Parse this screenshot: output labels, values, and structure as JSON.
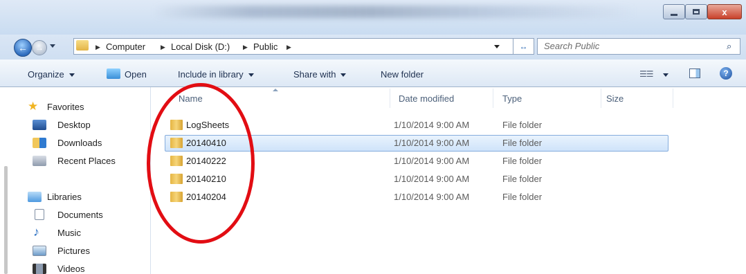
{
  "window": {
    "close_glyph": "x"
  },
  "address": {
    "crumbs": [
      "Computer",
      "Local Disk (D:)",
      "Public"
    ],
    "search_placeholder": "Search Public"
  },
  "toolbar": {
    "organize": "Organize",
    "open": "Open",
    "include_in_library": "Include in library",
    "share_with": "Share with",
    "new_folder": "New folder"
  },
  "nav": {
    "favorites_header": "Favorites",
    "favorites": [
      "Desktop",
      "Downloads",
      "Recent Places"
    ],
    "libraries_header": "Libraries",
    "libraries": [
      "Documents",
      "Music",
      "Pictures",
      "Videos"
    ]
  },
  "columns": {
    "name": "Name",
    "date_modified": "Date modified",
    "type": "Type",
    "size": "Size"
  },
  "files": [
    {
      "name": "LogSheets",
      "date": "1/10/2014 9:00 AM",
      "type": "File folder",
      "selected": false
    },
    {
      "name": "20140410",
      "date": "1/10/2014 9:00 AM",
      "type": "File folder",
      "selected": true
    },
    {
      "name": "20140222",
      "date": "1/10/2014 9:00 AM",
      "type": "File folder",
      "selected": false
    },
    {
      "name": "20140210",
      "date": "1/10/2014 9:00 AM",
      "type": "File folder",
      "selected": false
    },
    {
      "name": "20140204",
      "date": "1/10/2014 9:00 AM",
      "type": "File folder",
      "selected": false
    }
  ],
  "colors": {
    "annotation": "#e20d13",
    "selection": "#cfe3fa",
    "folder": "#f6d57a"
  }
}
